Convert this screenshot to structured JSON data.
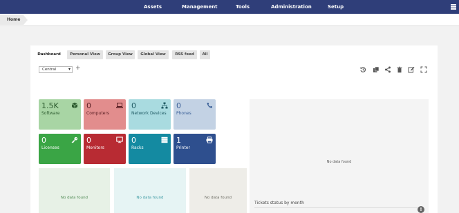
{
  "top_nav": {
    "items": [
      "Assets",
      "Management",
      "Tools",
      "Administration",
      "Setup"
    ],
    "menu_icon": "hamburger-icon",
    "background": "#2f3e79"
  },
  "breadcrumb": {
    "home": "Home"
  },
  "tabs": [
    {
      "label": "Dashboard",
      "active": true
    },
    {
      "label": "Personal View",
      "active": false
    },
    {
      "label": "Group View",
      "active": false
    },
    {
      "label": "Global View",
      "active": false
    },
    {
      "label": "RSS feed",
      "active": false
    },
    {
      "label": "All",
      "active": false
    }
  ],
  "dashboard_select": {
    "value": "Central"
  },
  "toolbar_icons": [
    "history-icon",
    "copy-icon",
    "share-icon",
    "trash-icon",
    "edit-icon",
    "fullscreen-icon"
  ],
  "tiles": [
    {
      "count": "1.5K",
      "label": "Software",
      "icon": "box-icon",
      "color": "#a8d5a4"
    },
    {
      "count": "0",
      "label": "Computers",
      "icon": "laptop-icon",
      "color": "#e28d8d"
    },
    {
      "count": "0",
      "label": "Network Devices",
      "icon": "network-icon",
      "color": "#a9dbe0"
    },
    {
      "count": "0",
      "label": "Phones",
      "icon": "phone-icon",
      "color": "#c3d2e4"
    },
    {
      "count": "0",
      "label": "Licenses",
      "icon": "key-icon",
      "color": "#3aa545"
    },
    {
      "count": "0",
      "label": "Monitors",
      "icon": "monitor-icon",
      "color": "#b82b33"
    },
    {
      "count": "0",
      "label": "Racks",
      "icon": "server-icon",
      "color": "#148aa1"
    },
    {
      "count": "1",
      "label": "Printer",
      "icon": "printer-icon",
      "color": "#2e4f8e"
    }
  ],
  "widgets": [
    {
      "text": "No data found",
      "background": "#e7f1e6",
      "color": "#4f8a53"
    },
    {
      "text": "No data found",
      "background": "#e6f4f4",
      "color": "#3d9aa3"
    },
    {
      "text": "No data found",
      "background": "#eeede8",
      "color": "#6c6c64"
    }
  ],
  "tickets_panel": {
    "nodata": "No data found",
    "title": "Tickets status by month"
  },
  "info_button": "!"
}
